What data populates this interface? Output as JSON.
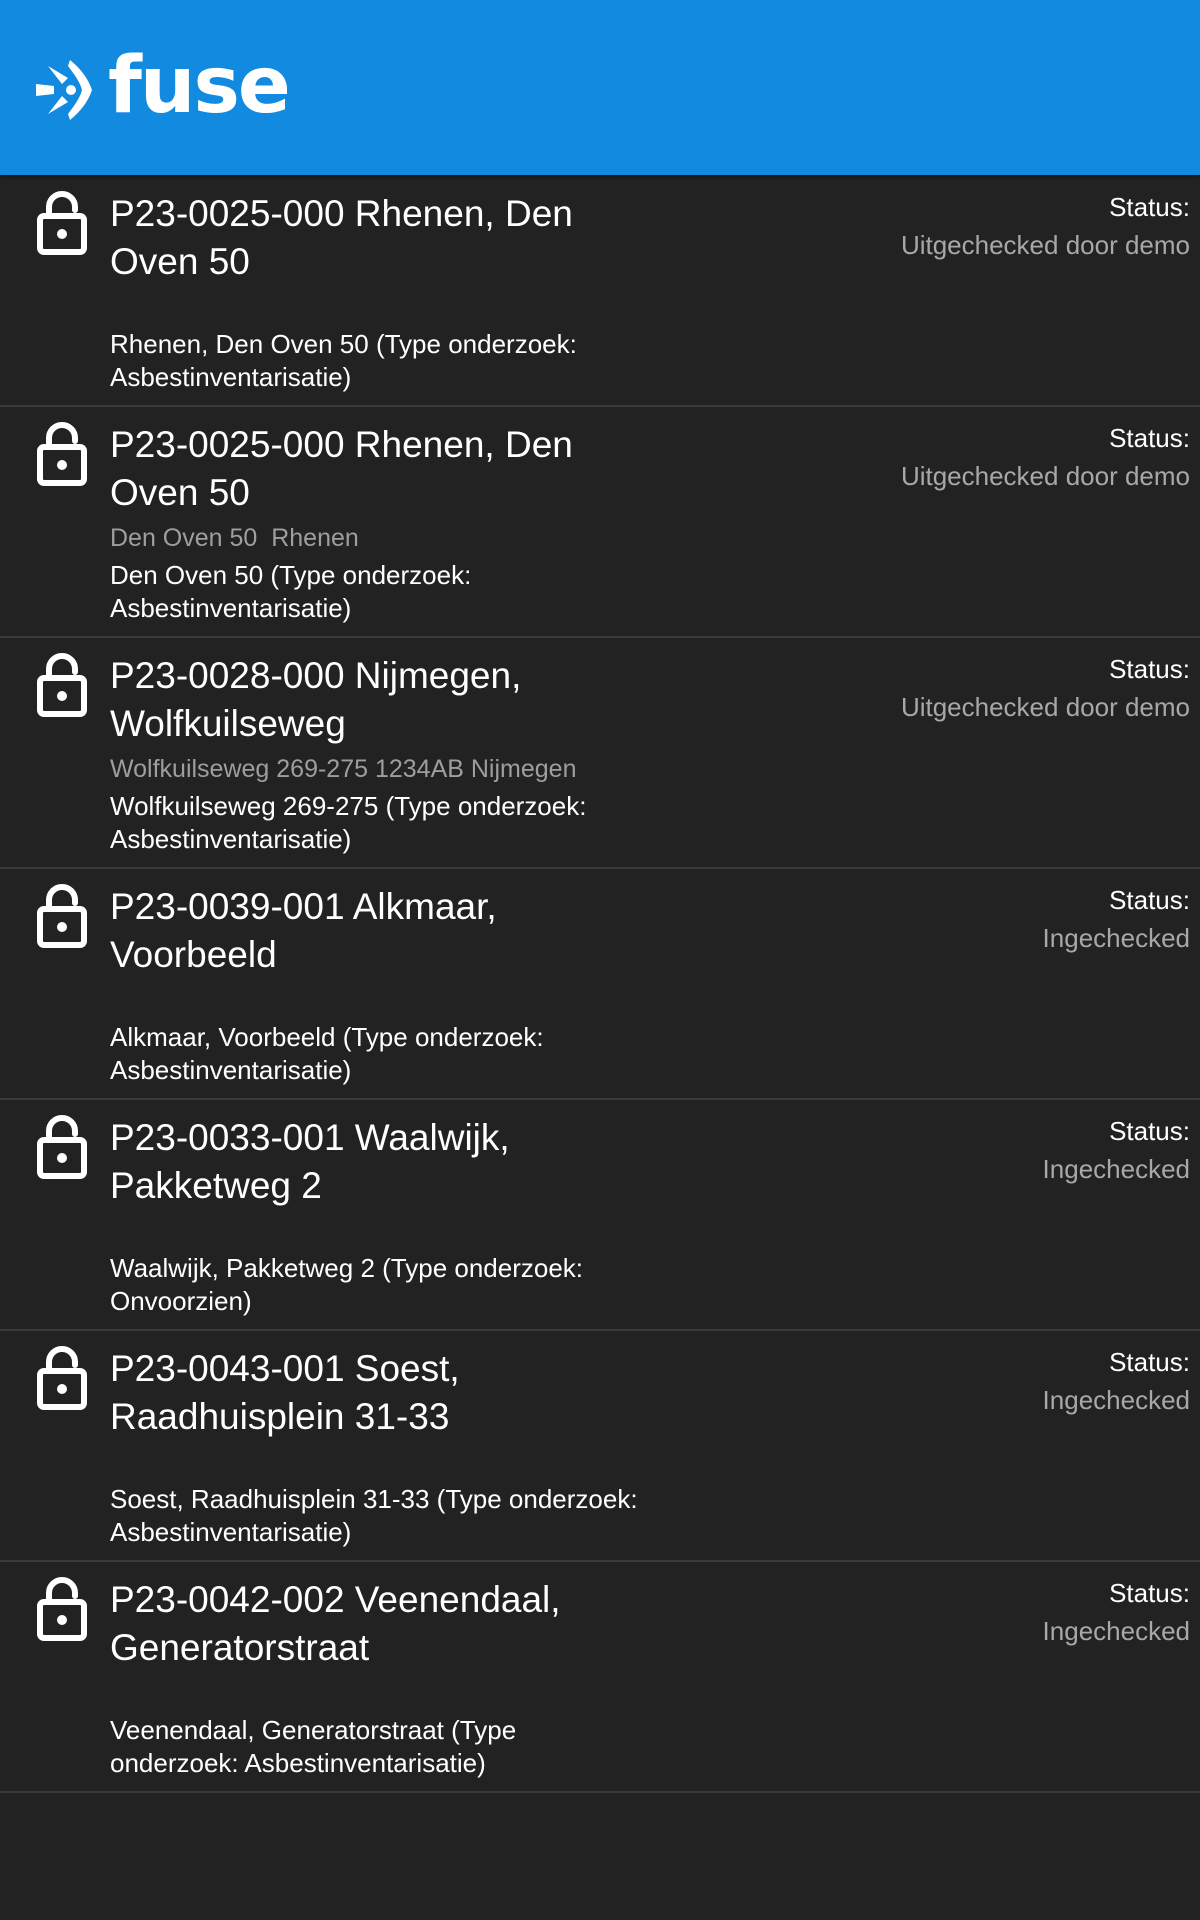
{
  "app": {
    "brand": "fuse",
    "header_color": "#128ae0",
    "background_color": "#222222"
  },
  "projects": [
    {
      "title": "P23-0025-000 Rhenen, Den Oven 50",
      "address": "",
      "description": "Rhenen, Den Oven 50 (Type onderzoek: Asbestinventarisatie)",
      "status_label": "Status:",
      "status": "Uitgechecked door demo",
      "icon": "lock-icon"
    },
    {
      "title": "P23-0025-000 Rhenen, Den Oven 50",
      "address": "Den Oven 50  Rhenen",
      "description": "Den Oven 50 (Type onderzoek: Asbestinventarisatie)",
      "status_label": "Status:",
      "status": "Uitgechecked door demo",
      "icon": "lock-icon"
    },
    {
      "title": "P23-0028-000 Nijmegen, Wolfkuilseweg",
      "address": "Wolfkuilseweg 269-275 1234AB Nijmegen",
      "description": "Wolfkuilseweg 269-275 (Type onderzoek: Asbestinventarisatie)",
      "status_label": "Status:",
      "status": "Uitgechecked door demo",
      "icon": "lock-icon"
    },
    {
      "title": "P23-0039-001 Alkmaar, Voorbeeld",
      "address": "",
      "description": "Alkmaar, Voorbeeld (Type onderzoek: Asbestinventarisatie)",
      "status_label": "Status:",
      "status": "Ingechecked",
      "icon": "lock-icon"
    },
    {
      "title": "P23-0033-001 Waalwijk, Pakketweg 2",
      "address": "",
      "description": "Waalwijk, Pakketweg 2 (Type onderzoek: Onvoorzien)",
      "status_label": "Status:",
      "status": "Ingechecked",
      "icon": "lock-icon"
    },
    {
      "title": "P23-0043-001 Soest, Raadhuisplein 31-33",
      "address": "",
      "description": "Soest, Raadhuisplein 31-33 (Type onderzoek: Asbestinventarisatie)",
      "status_label": "Status:",
      "status": "Ingechecked",
      "icon": "lock-icon"
    },
    {
      "title": "P23-0042-002 Veenendaal, Generatorstraat",
      "address": "",
      "description": "Veenendaal, Generatorstraat (Type onderzoek: Asbestinventarisatie)",
      "status_label": "Status:",
      "status": "Ingechecked",
      "icon": "lock-icon"
    }
  ]
}
